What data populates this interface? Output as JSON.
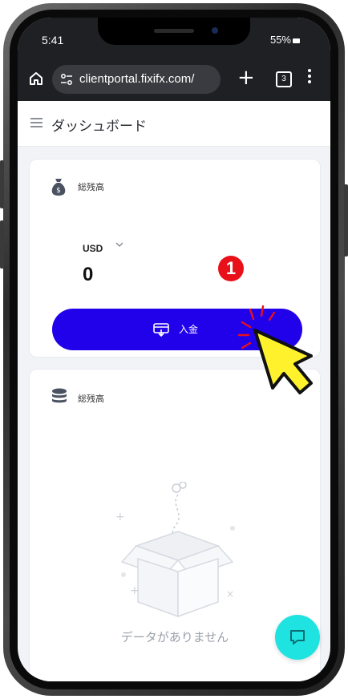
{
  "status_bar": {
    "time": "5:41",
    "battery": "55%"
  },
  "browser": {
    "url": "clientportal.fixifx.com/",
    "tab_count": "3"
  },
  "app": {
    "title": "ダッシュボード"
  },
  "balance_card": {
    "title": "総残高",
    "currency": "USD",
    "amount": "0",
    "deposit_label": "入金"
  },
  "annotation": {
    "step": "1",
    "badge_color": "#e8111a"
  },
  "assets_card": {
    "title": "総残高",
    "empty_text": "データがありません"
  },
  "colors": {
    "deposit_button": "#2100ea",
    "chat_button": "#1fe3e0",
    "browser_bar": "#1f2024"
  },
  "icons": [
    "home-icon",
    "site-settings-icon",
    "new-tab-icon",
    "tab-switcher-icon",
    "more-menu-icon",
    "hamburger-menu-icon",
    "money-bag-icon",
    "chevron-down-icon",
    "deposit-icon",
    "coins-stack-icon",
    "empty-box-illustration",
    "chat-icon",
    "pointer-hand-icon"
  ]
}
